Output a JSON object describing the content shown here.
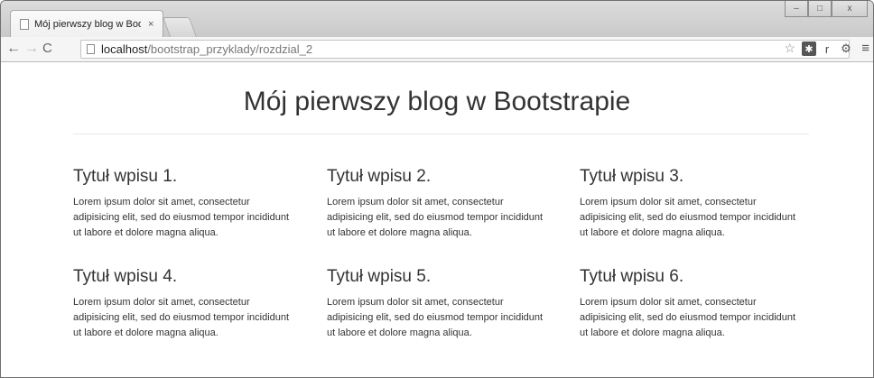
{
  "browser": {
    "tab_title": "Mój pierwszy blog w Boot",
    "tab_close": "×",
    "url_host": "localhost",
    "url_path": "/bootstrap_przyklady/rozdzial_2",
    "window_controls": [
      "–",
      "□",
      "x"
    ],
    "icons": [
      "back-icon",
      "forward-icon",
      "reload-icon",
      "page-icon",
      "star-icon",
      "extension-icon",
      "menu-icon"
    ]
  },
  "page": {
    "title": "Mój pierwszy blog w Bootstrapie",
    "posts": [
      {
        "title": "Tytuł wpisu 1.",
        "body": "Lorem ipsum dolor sit amet, consectetur adipisicing elit, sed do eiusmod tempor incididunt ut labore et dolore magna aliqua."
      },
      {
        "title": "Tytuł wpisu 2.",
        "body": "Lorem ipsum dolor sit amet, consectetur adipisicing elit, sed do eiusmod tempor incididunt ut labore et dolore magna aliqua."
      },
      {
        "title": "Tytuł wpisu 3.",
        "body": "Lorem ipsum dolor sit amet, consectetur adipisicing elit, sed do eiusmod tempor incididunt ut labore et dolore magna aliqua."
      },
      {
        "title": "Tytuł wpisu 4.",
        "body": "Lorem ipsum dolor sit amet, consectetur adipisicing elit, sed do eiusmod tempor incididunt ut labore et dolore magna aliqua."
      },
      {
        "title": "Tytuł wpisu 5.",
        "body": "Lorem ipsum dolor sit amet, consectetur adipisicing elit, sed do eiusmod tempor incididunt ut labore et dolore magna aliqua."
      },
      {
        "title": "Tytuł wpisu 6.",
        "body": "Lorem ipsum dolor sit amet, consectetur adipisicing elit, sed do eiusmod tempor incididunt ut labore et dolore magna aliqua."
      }
    ]
  }
}
